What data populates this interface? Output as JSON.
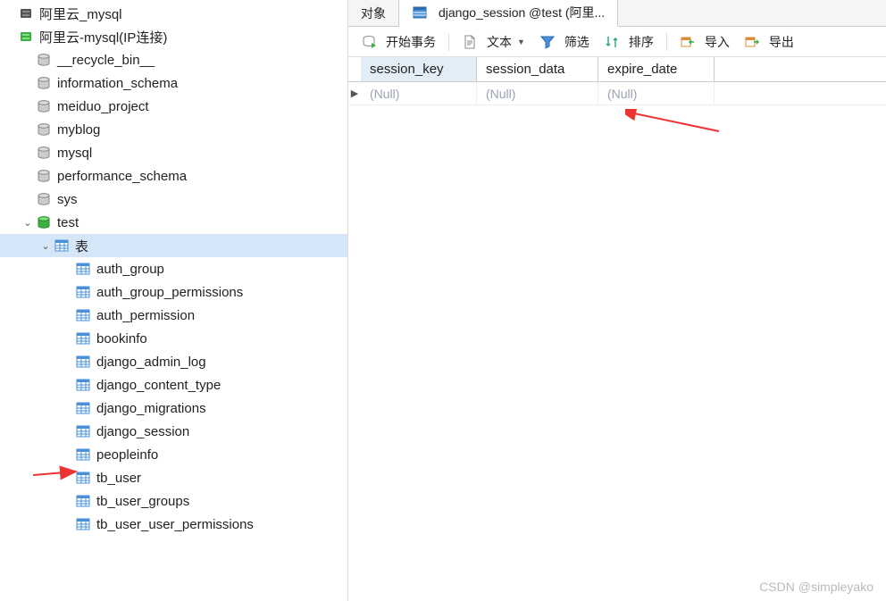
{
  "sidebar": {
    "nodes": [
      {
        "label": "阿里云_mysql",
        "icon": "server-closed",
        "indent": 0,
        "tw": ""
      },
      {
        "label": "阿里云-mysql(IP连接)",
        "icon": "server-open",
        "indent": 0,
        "tw": ""
      },
      {
        "label": "__recycle_bin__",
        "icon": "db",
        "indent": 1,
        "tw": ""
      },
      {
        "label": "information_schema",
        "icon": "db",
        "indent": 1,
        "tw": ""
      },
      {
        "label": "meiduo_project",
        "icon": "db",
        "indent": 1,
        "tw": ""
      },
      {
        "label": "myblog",
        "icon": "db",
        "indent": 1,
        "tw": ""
      },
      {
        "label": "mysql",
        "icon": "db",
        "indent": 1,
        "tw": ""
      },
      {
        "label": "performance_schema",
        "icon": "db",
        "indent": 1,
        "tw": ""
      },
      {
        "label": "sys",
        "icon": "db",
        "indent": 1,
        "tw": ""
      },
      {
        "label": "test",
        "icon": "db-open",
        "indent": 1,
        "tw": "expanded"
      },
      {
        "label": "表",
        "icon": "table",
        "indent": 2,
        "tw": "expanded",
        "selected": true
      },
      {
        "label": "auth_group",
        "icon": "table",
        "indent": 3,
        "tw": ""
      },
      {
        "label": "auth_group_permissions",
        "icon": "table",
        "indent": 3,
        "tw": ""
      },
      {
        "label": "auth_permission",
        "icon": "table",
        "indent": 3,
        "tw": ""
      },
      {
        "label": "bookinfo",
        "icon": "table",
        "indent": 3,
        "tw": ""
      },
      {
        "label": "django_admin_log",
        "icon": "table",
        "indent": 3,
        "tw": ""
      },
      {
        "label": "django_content_type",
        "icon": "table",
        "indent": 3,
        "tw": ""
      },
      {
        "label": "django_migrations",
        "icon": "table",
        "indent": 3,
        "tw": ""
      },
      {
        "label": "django_session",
        "icon": "table",
        "indent": 3,
        "tw": "",
        "arrow": true
      },
      {
        "label": "peopleinfo",
        "icon": "table",
        "indent": 3,
        "tw": ""
      },
      {
        "label": "tb_user",
        "icon": "table",
        "indent": 3,
        "tw": ""
      },
      {
        "label": "tb_user_groups",
        "icon": "table",
        "indent": 3,
        "tw": ""
      },
      {
        "label": "tb_user_user_permissions",
        "icon": "table",
        "indent": 3,
        "tw": ""
      }
    ]
  },
  "tabs": {
    "obj": "对象",
    "active_label": "django_session @test (阿里..."
  },
  "toolbar": {
    "begin_tx": "开始事务",
    "text": "文本",
    "filter": "筛选",
    "sort": "排序",
    "import": "导入",
    "export": "导出"
  },
  "grid": {
    "columns": [
      "session_key",
      "session_data",
      "expire_date"
    ],
    "rows": [
      {
        "session_key": "(Null)",
        "session_data": "(Null)",
        "expire_date": "(Null)"
      }
    ]
  },
  "watermark": "CSDN @simpleyako"
}
